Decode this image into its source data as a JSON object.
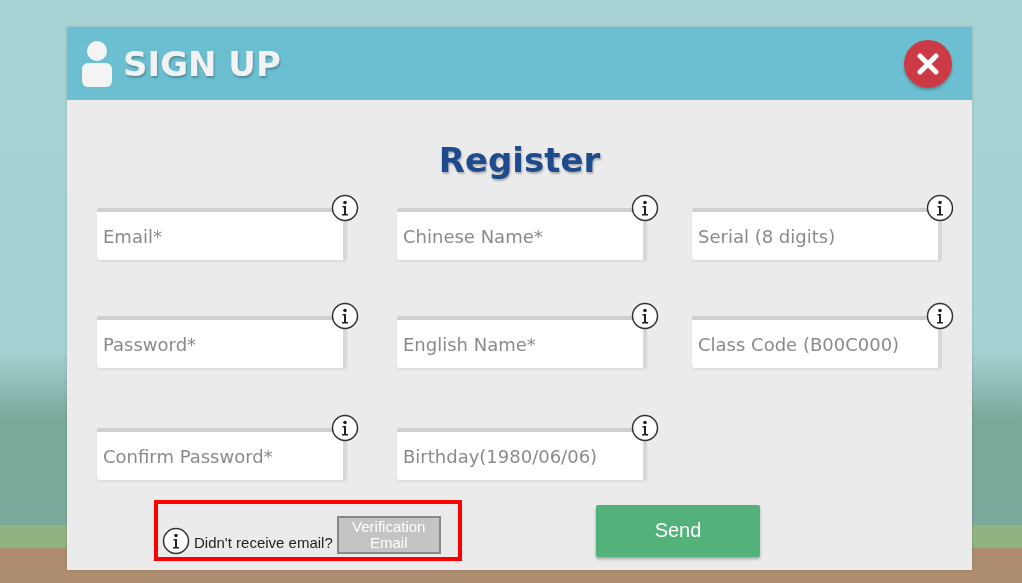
{
  "dialog": {
    "title": "SIGN UP",
    "heading": "Register"
  },
  "fields": [
    {
      "placeholder": "Email*"
    },
    {
      "placeholder": "Chinese Name*"
    },
    {
      "placeholder": "Serial (8 digits)"
    },
    {
      "placeholder": "Password*"
    },
    {
      "placeholder": "English Name*"
    },
    {
      "placeholder": "Class Code (B00C000)"
    },
    {
      "placeholder": "Confirm Password*"
    },
    {
      "placeholder": "Birthday(1980/06/06)"
    }
  ],
  "resend": {
    "text": "Didn't receive email?",
    "button": "Verification Email",
    "highlighted": true
  },
  "send_button": "Send"
}
